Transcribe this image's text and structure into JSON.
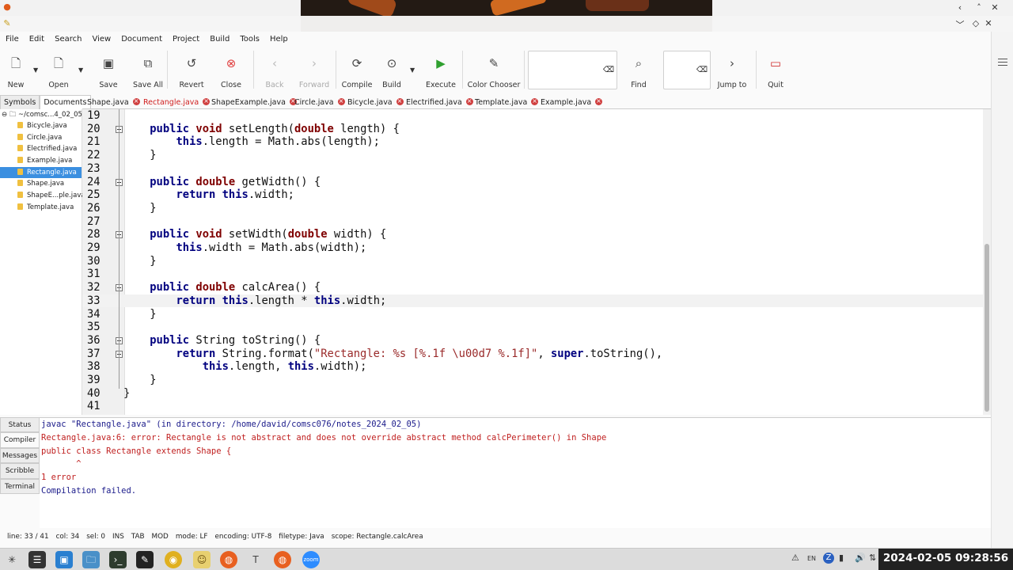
{
  "menu": [
    "File",
    "Edit",
    "Search",
    "View",
    "Document",
    "Project",
    "Build",
    "Tools",
    "Help"
  ],
  "toolbar": {
    "new": "New",
    "open": "Open",
    "save": "Save",
    "save_all": "Save All",
    "revert": "Revert",
    "close": "Close",
    "back": "Back",
    "forward": "Forward",
    "compile": "Compile",
    "build": "Build",
    "execute": "Execute",
    "color_chooser": "Color Chooser",
    "find": "Find",
    "jump_to": "Jump to",
    "quit": "Quit"
  },
  "sidebar": {
    "tabs": [
      "Symbols",
      "Documents"
    ],
    "root": "~/comsc...4_02_05",
    "files": [
      "Bicycle.java",
      "Circle.java",
      "Electrified.java",
      "Example.java",
      "Rectangle.java",
      "Shape.java",
      "ShapeE...ple.java",
      "Template.java"
    ],
    "selected_index": 4
  },
  "editor_tabs": [
    "Shape.java",
    "Rectangle.java",
    "ShapeExample.java",
    "Circle.java",
    "Bicycle.java",
    "Electrified.java",
    "Template.java",
    "Example.java"
  ],
  "active_tab_index": 1,
  "code": {
    "lines": [
      {
        "n": "19",
        "t": ""
      },
      {
        "n": "20",
        "t": ""
      },
      {
        "n": "21",
        "t": ""
      },
      {
        "n": "22",
        "t": ""
      },
      {
        "n": "23",
        "t": ""
      },
      {
        "n": "24",
        "t": ""
      },
      {
        "n": "25",
        "t": ""
      },
      {
        "n": "26",
        "t": ""
      },
      {
        "n": "27",
        "t": ""
      },
      {
        "n": "28",
        "t": ""
      },
      {
        "n": "29",
        "t": ""
      },
      {
        "n": "30",
        "t": ""
      },
      {
        "n": "31",
        "t": ""
      },
      {
        "n": "32",
        "t": ""
      },
      {
        "n": "33",
        "t": ""
      },
      {
        "n": "34",
        "t": ""
      },
      {
        "n": "35",
        "t": ""
      },
      {
        "n": "36",
        "t": ""
      },
      {
        "n": "37",
        "t": ""
      },
      {
        "n": "38",
        "t": ""
      },
      {
        "n": "39",
        "t": ""
      },
      {
        "n": "40",
        "t": ""
      },
      {
        "n": "41",
        "t": ""
      }
    ],
    "source": [
      "",
      "    public void setLength(double length) {",
      "        this.length = Math.abs(length);",
      "    }",
      "",
      "    public double getWidth() {",
      "        return this.width;",
      "    }",
      "",
      "    public void setWidth(double width) {",
      "        this.width = Math.abs(width);",
      "    }",
      "",
      "    public double calcArea() {",
      "        return this.length * this.width;",
      "    }",
      "",
      "    public String toString() {",
      "        return String.format(\"Rectangle: %s [%.1f \\u00d7 %.1f]\", super.toString(),",
      "            this.length, this.width);",
      "    }",
      "}",
      ""
    ],
    "current_line": 33
  },
  "message_tabs": [
    "Status",
    "Compiler",
    "Messages",
    "Scribble",
    "Terminal"
  ],
  "active_message_tab": 1,
  "compiler_output": [
    {
      "text": "javac \"Rectangle.java\" (in directory: /home/david/comsc076/notes_2024_02_05)",
      "error": false
    },
    {
      "text": "Rectangle.java:6: error: Rectangle is not abstract and does not override abstract method calcPerimeter() in Shape",
      "error": true
    },
    {
      "text": "public class Rectangle extends Shape {",
      "error": true
    },
    {
      "text": "       ^",
      "error": true
    },
    {
      "text": "1 error",
      "error": true
    },
    {
      "text": "Compilation failed.",
      "error": false
    }
  ],
  "status": {
    "line": "line: 33 / 41",
    "col": "col: 34",
    "sel": "sel: 0",
    "ins": "INS",
    "tab": "TAB",
    "mod": "MOD",
    "mode": "mode: LF",
    "encoding": "encoding: UTF-8",
    "filetype": "filetype: Java",
    "scope": "scope: Rectangle.calcArea"
  },
  "tray": {
    "lang": "EN"
  },
  "clock": "2024-02-05  09:28:56"
}
